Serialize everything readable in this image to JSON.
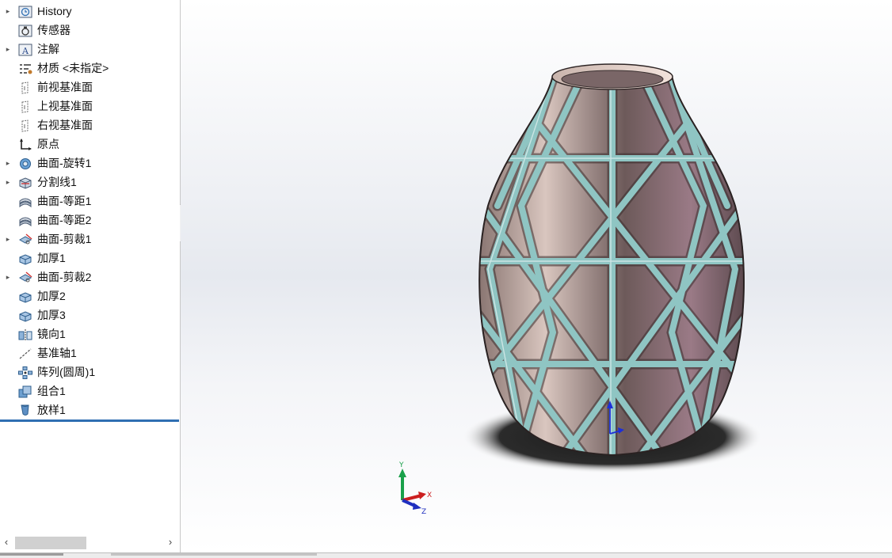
{
  "feature_tree": {
    "items": [
      {
        "label": "History",
        "icon": "history-icon",
        "expandable": true
      },
      {
        "label": "传感器",
        "icon": "sensor-icon",
        "expandable": false
      },
      {
        "label": "注解",
        "icon": "annotation-icon",
        "expandable": true
      },
      {
        "label": "材质 <未指定>",
        "icon": "material-icon",
        "expandable": false
      },
      {
        "label": "前视基准面",
        "icon": "plane-icon",
        "expandable": false
      },
      {
        "label": "上视基准面",
        "icon": "plane-icon",
        "expandable": false
      },
      {
        "label": "右视基准面",
        "icon": "plane-icon",
        "expandable": false
      },
      {
        "label": "原点",
        "icon": "origin-icon",
        "expandable": false
      },
      {
        "label": "曲面-旋转1",
        "icon": "surface-revolve-icon",
        "expandable": true
      },
      {
        "label": "分割线1",
        "icon": "split-line-icon",
        "expandable": true
      },
      {
        "label": "曲面-等距1",
        "icon": "surface-offset-icon",
        "expandable": false
      },
      {
        "label": "曲面-等距2",
        "icon": "surface-offset-icon",
        "expandable": false
      },
      {
        "label": "曲面-剪裁1",
        "icon": "surface-trim-icon",
        "expandable": true
      },
      {
        "label": "加厚1",
        "icon": "thicken-icon",
        "expandable": false
      },
      {
        "label": "曲面-剪裁2",
        "icon": "surface-trim-icon",
        "expandable": true
      },
      {
        "label": "加厚2",
        "icon": "thicken-icon",
        "expandable": false
      },
      {
        "label": "加厚3",
        "icon": "thicken-icon",
        "expandable": false
      },
      {
        "label": "镜向1",
        "icon": "mirror-icon",
        "expandable": false
      },
      {
        "label": "基准轴1",
        "icon": "axis-icon",
        "expandable": false
      },
      {
        "label": "阵列(圆周)1",
        "icon": "circular-pattern-icon",
        "expandable": false
      },
      {
        "label": "组合1",
        "icon": "combine-icon",
        "expandable": false
      },
      {
        "label": "放样1",
        "icon": "loft-icon",
        "expandable": false
      }
    ],
    "scroll_left": "‹",
    "scroll_right": "›"
  },
  "triad": {
    "x": "X",
    "y": "Y",
    "z": "Z"
  },
  "colors": {
    "frame": "#8fc5c3",
    "panel_fill": "#b9a39d",
    "panel_shadow": "#5a4a4a",
    "accent_blue": "#2f6fb2"
  }
}
